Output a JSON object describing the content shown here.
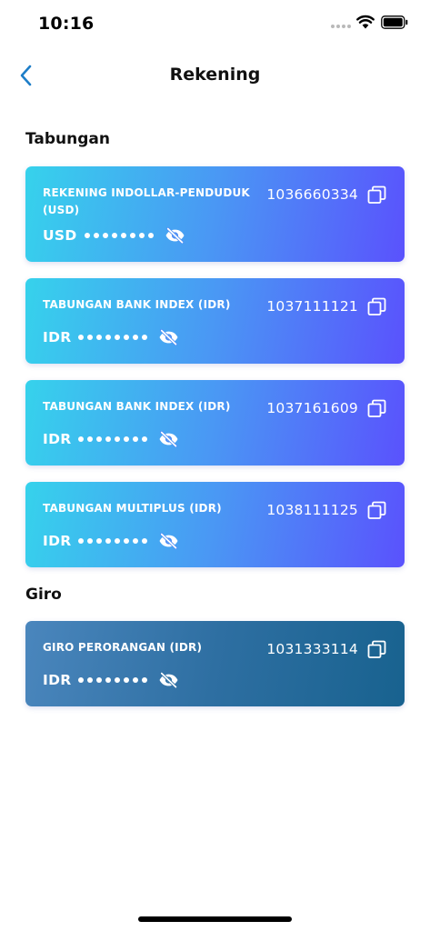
{
  "status_bar": {
    "time": "10:16"
  },
  "header": {
    "title": "Rekening"
  },
  "sections": [
    {
      "title": "Tabungan",
      "accounts": [
        {
          "name": "REKENING INDOLLAR-PENDUDUK (USD)",
          "number": "1036660334",
          "currency": "USD"
        },
        {
          "name": "TABUNGAN BANK INDEX (IDR)",
          "number": "1037111121",
          "currency": "IDR"
        },
        {
          "name": "TABUNGAN BANK INDEX (IDR)",
          "number": "1037161609",
          "currency": "IDR"
        },
        {
          "name": "TABUNGAN MULTIPLUS (IDR)",
          "number": "1038111125",
          "currency": "IDR"
        }
      ]
    },
    {
      "title": "Giro",
      "accounts": [
        {
          "name": "GIRO PERORANGAN (IDR)",
          "number": "1031333114",
          "currency": "IDR"
        }
      ]
    }
  ],
  "colors": {
    "accent": "#1e7ec8",
    "tabungan_gradient": [
      "#36d2ec",
      "#5a52fd"
    ],
    "giro_gradient": [
      "#4a86bd",
      "#18628f"
    ]
  },
  "icons": {
    "back": "chevron-left-icon",
    "copy": "copy-icon",
    "hide_balance": "eye-off-icon"
  }
}
